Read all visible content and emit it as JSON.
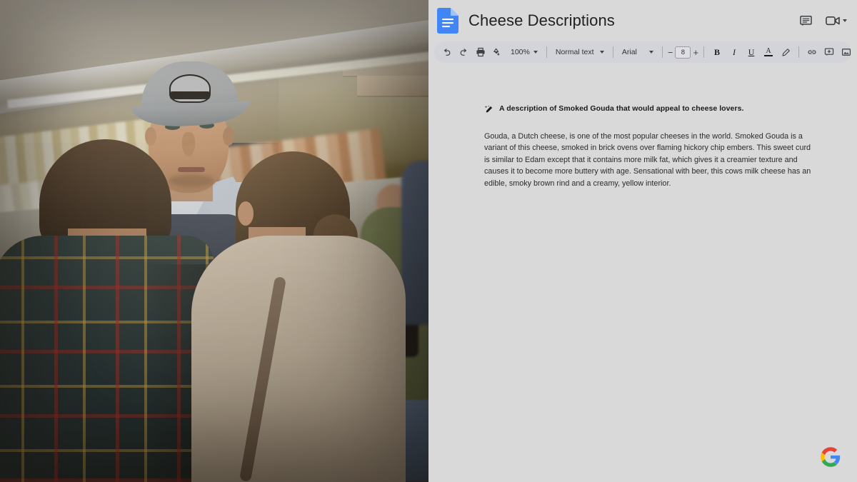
{
  "app": {
    "name": "Google Docs",
    "logo_icon": "google-docs-icon",
    "brand_colors": {
      "docs_blue": "#4285F4",
      "google_red": "#EA4335",
      "google_yellow": "#FBBC05",
      "google_green": "#34A853",
      "toolbar_bg": "#D3D3DA",
      "canvas_bg": "#D9D9D9"
    }
  },
  "header": {
    "title": "Cheese Descriptions",
    "actions": [
      {
        "name": "comment-history-button",
        "icon": "comment-icon"
      },
      {
        "name": "meet-button",
        "icon": "video-camera-icon",
        "has_caret": true
      }
    ]
  },
  "toolbar": {
    "undo_icon": "undo-icon",
    "redo_icon": "redo-icon",
    "print_icon": "print-icon",
    "spellcheck_icon": "spellcheck-icon",
    "zoom_value": "100%",
    "style_value": "Normal text",
    "font_value": "Arial",
    "font_size_decrease": "−",
    "font_size_value": "8",
    "font_size_increase": "+",
    "bold_label": "B",
    "italic_label": "I",
    "underline_label": "U",
    "text_color_label": "A",
    "highlight_icon": "highlight-pen-icon",
    "link_icon": "link-icon",
    "comment_icon": "add-comment-icon",
    "image_icon": "insert-image-icon",
    "align_icon": "align-left-icon",
    "list_icon": "numbered-list-icon",
    "checklist_icon": "checklist-icon",
    "more_icon": "more-options-icon"
  },
  "document": {
    "heading_icon": "ai-magic-pen-icon",
    "heading": "A description of Smoked Gouda that would appeal to cheese lovers.",
    "paragraph": "Gouda, a Dutch cheese, is one of the most popular cheeses in the world. Smoked Gouda is a variant of this cheese, smoked in brick ovens over flaming hickory chip embers. This sweet curd is similar to Edam except that it contains more milk fat, which gives it a creamier texture and causes it to become more buttery with age. Sensational with beer, this cows milk cheese has an edible, smoky brown rind and a creamy, yellow interior."
  },
  "watermark": {
    "name": "google-logo",
    "alt": "Google"
  },
  "video": {
    "name": "supermarket-cheese-counter-scene",
    "description": "A cheesemonger in a grey cap and dark apron stands behind a refrigerated cheese case talking to two customers seen from behind."
  }
}
